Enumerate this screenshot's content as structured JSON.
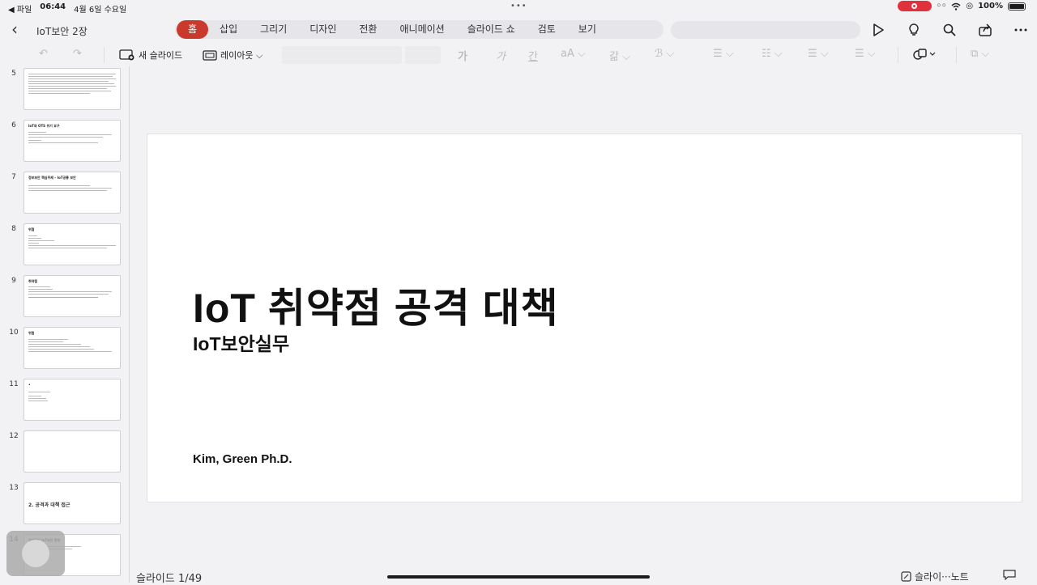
{
  "status": {
    "back_app": "◀ 파일",
    "time": "06:44",
    "date": "4월 6일 수요일",
    "battery": "100%"
  },
  "topbar": {
    "doc_title": "IoT보안 2장",
    "tabs": [
      "홈",
      "삽입",
      "그리기",
      "디자인",
      "전환",
      "애니메이션",
      "슬라이드 쇼",
      "검토",
      "보기"
    ]
  },
  "toolbar": {
    "new_slide": "새 슬라이드",
    "layout": "레이아웃 ⌵",
    "bold": "가",
    "italic": "가",
    "underline": "간",
    "font_size": "aA ⌵",
    "highlight": "갊 ⌵",
    "color": "ℬ ⌵",
    "accent": "#c93a2c"
  },
  "thumbnails": [
    {
      "num": "5",
      "title": "",
      "center": ""
    },
    {
      "num": "6",
      "title": "IoT와 OTS 위기 요구",
      "center": ""
    },
    {
      "num": "7",
      "title": "정보보안 핵심주제 – IoT공통 보안",
      "center": ""
    },
    {
      "num": "8",
      "title": "위협",
      "center": ""
    },
    {
      "num": "9",
      "title": "취약점",
      "center": ""
    },
    {
      "num": "10",
      "title": "위험",
      "center": ""
    },
    {
      "num": "11",
      "title": "•",
      "center": ""
    },
    {
      "num": "12",
      "title": "",
      "center": ""
    },
    {
      "num": "13",
      "title": "",
      "center": "2. 공격과 대책 접근"
    },
    {
      "num": "14",
      "title": "일반적인 IoT보안 문제",
      "center": ""
    }
  ],
  "slide": {
    "title": "IoT 취약점 공격 대책",
    "subtitle": "IoT보안실무",
    "author": "Kim, Green Ph.D."
  },
  "bottom": {
    "counter": "슬라이드 1/49",
    "notes": "슬라이···노트"
  }
}
